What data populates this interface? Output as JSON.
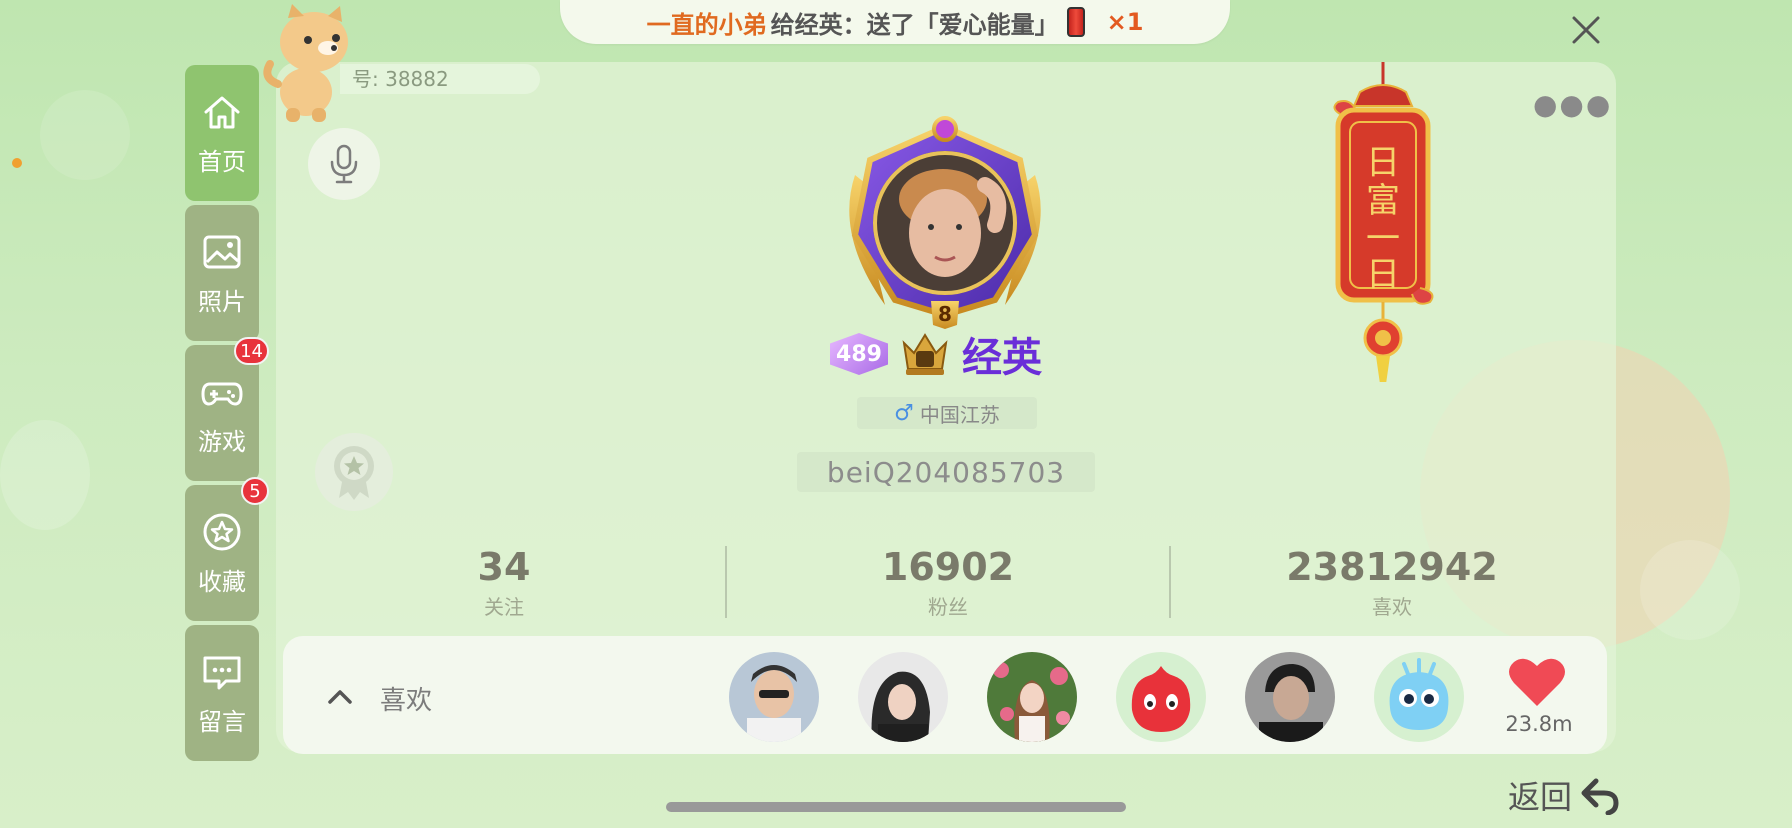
{
  "banner": {
    "sender": "一直的小弟",
    "action": "给经英：送了「爱心能量」",
    "count": "×1"
  },
  "sidebar": {
    "items": [
      {
        "label": "首页",
        "icon": "home-icon",
        "active": true
      },
      {
        "label": "照片",
        "icon": "photo-icon"
      },
      {
        "label": "游戏",
        "icon": "gamepad-icon",
        "badge": "14"
      },
      {
        "label": "收藏",
        "icon": "star-icon",
        "badge": "5"
      },
      {
        "label": "留言",
        "icon": "message-icon"
      }
    ]
  },
  "profile": {
    "id_text": "号: 38882",
    "avatar_level": "8",
    "level": "489",
    "name": "经英",
    "location": "中国江苏",
    "uid": "beiQ204085703"
  },
  "lantern": {
    "text": "日富一日"
  },
  "stats": [
    {
      "value": "34",
      "label": "关注"
    },
    {
      "value": "16902",
      "label": "粉丝"
    },
    {
      "value": "23812942",
      "label": "喜欢"
    }
  ],
  "likes": {
    "label": "喜欢",
    "heart_count": "23.8m"
  },
  "footer": {
    "return_label": "返回"
  },
  "colors": {
    "accent_green": "#8fc46f",
    "name_purple": "#6a2ed8",
    "heart_red": "#f04a55",
    "badge_red": "#e8333c"
  }
}
